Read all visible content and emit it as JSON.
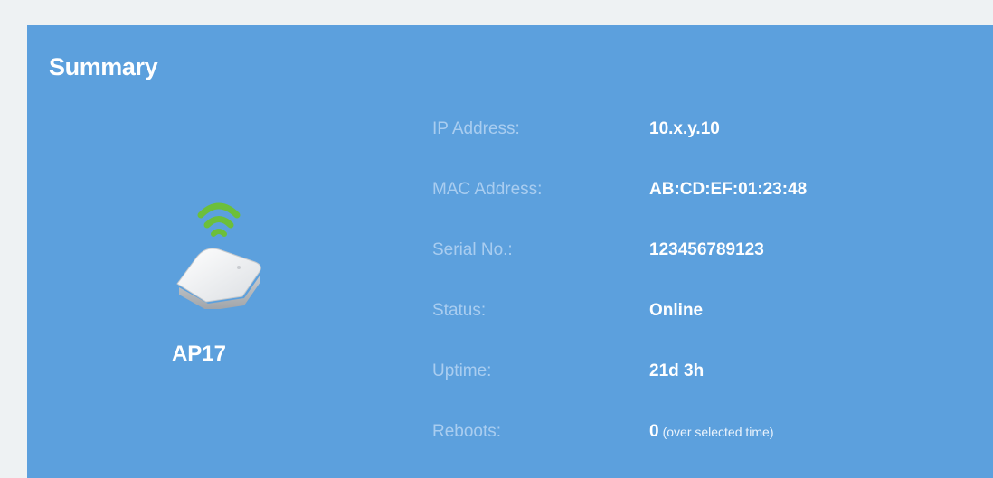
{
  "summary": {
    "title": "Summary",
    "device": {
      "name": "AP17",
      "icon": "wifi-access-point-icon"
    },
    "fields": [
      {
        "label": "IP Address:",
        "value": "10.x.y.10"
      },
      {
        "label": "MAC Address:",
        "value": "AB:CD:EF:01:23:48"
      },
      {
        "label": "Serial No.:",
        "value": "123456789123"
      },
      {
        "label": "Status:",
        "value": "Online"
      },
      {
        "label": "Uptime:",
        "value": "21d 3h"
      },
      {
        "label": "Reboots:",
        "value": "0",
        "note": "(over selected time)"
      }
    ]
  },
  "colors": {
    "panel": "#5ca0dd",
    "background": "#eef2f3",
    "label": "#a9cdf0",
    "value": "#ffffff",
    "wifi": "#6cbf3a"
  }
}
